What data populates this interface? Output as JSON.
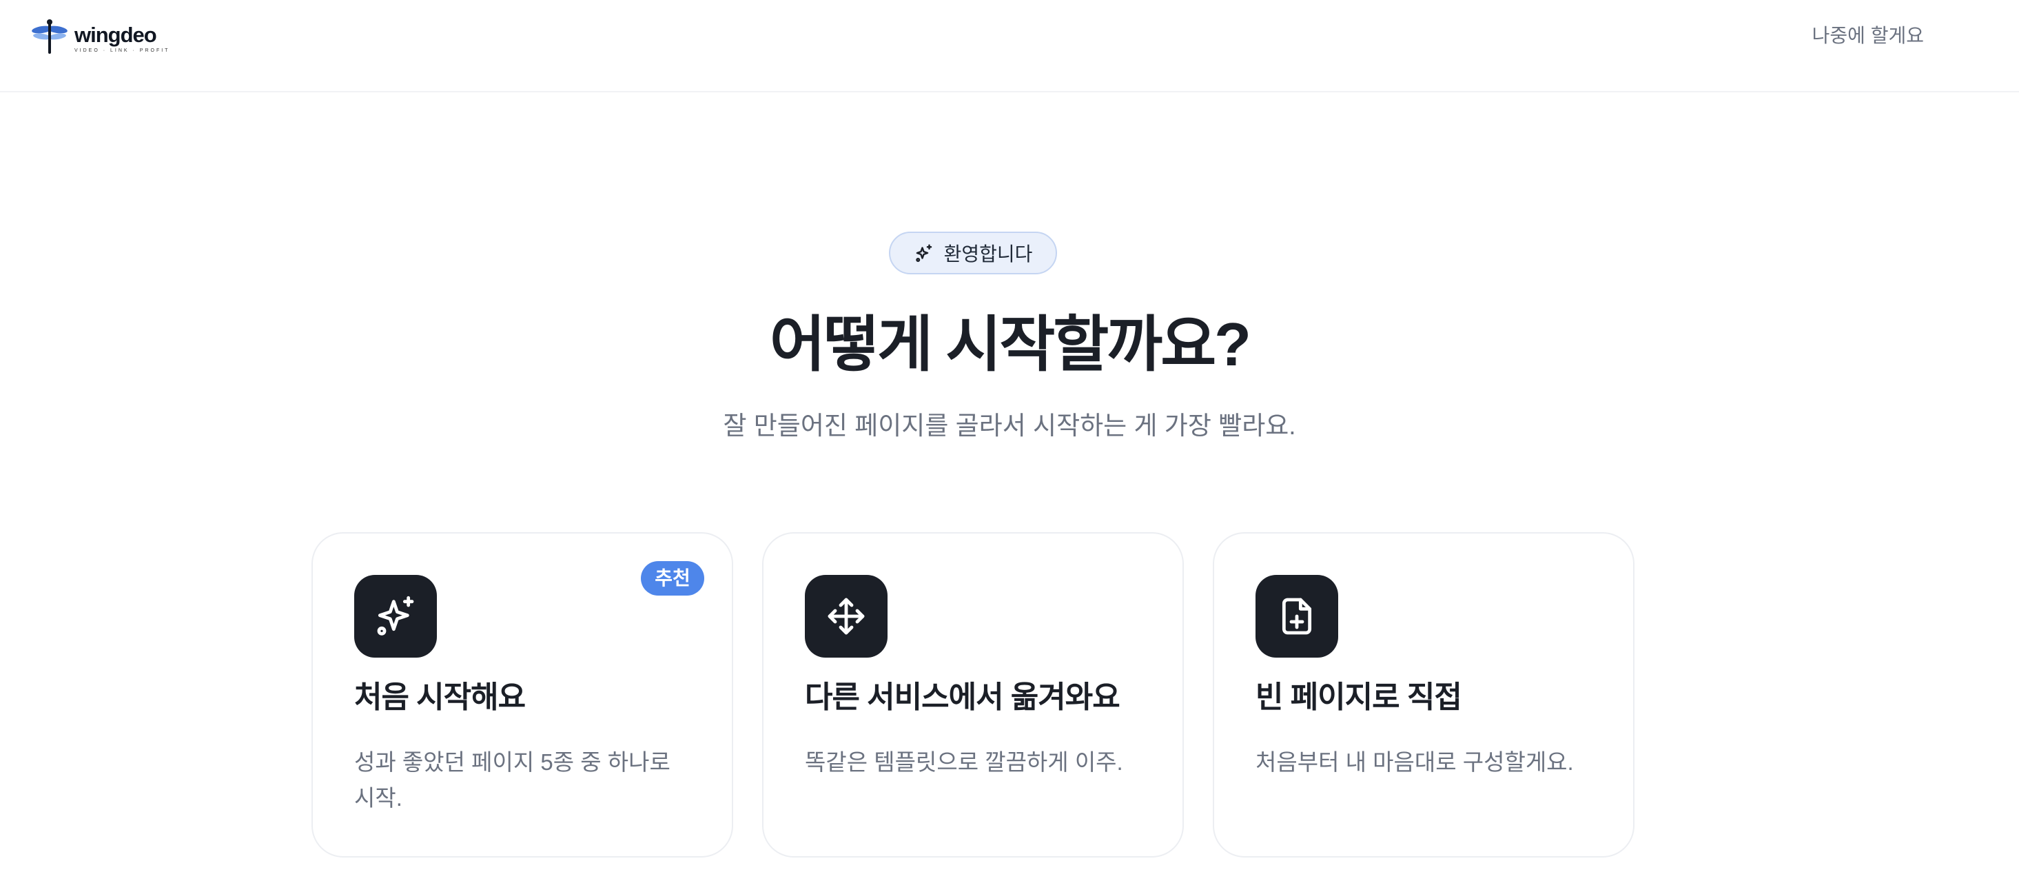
{
  "header": {
    "logo": {
      "name": "wingdeo",
      "tagline": "VIDEO · LINK · PROFIT"
    },
    "skip_label": "나중에 할게요"
  },
  "welcome_pill": {
    "label": "환영합니다",
    "icon": "sparkle-icon"
  },
  "title": "어떻게 시작할까요?",
  "subtitle": "잘 만들어진 페이지를 골라서 시작하는 게 가장 빨라요.",
  "options": [
    {
      "title": "처음 시작해요",
      "description": "성과 좋았던 페이지 5종 중 하나로 시작.",
      "icon": "sparkles-icon",
      "badge": "추천"
    },
    {
      "title": "다른 서비스에서 옮겨와요",
      "description": "똑같은 템플릿으로 깔끔하게 이주.",
      "icon": "move-icon"
    },
    {
      "title": "빈 페이지로 직접",
      "description": "처음부터 내 마음대로 구성할게요.",
      "icon": "file-plus-icon"
    }
  ],
  "colors": {
    "accent": "#4e86ea",
    "icon_bg": "#1b1f27",
    "text_muted": "#6b7280",
    "pill_bg": "#eaf0fb"
  }
}
